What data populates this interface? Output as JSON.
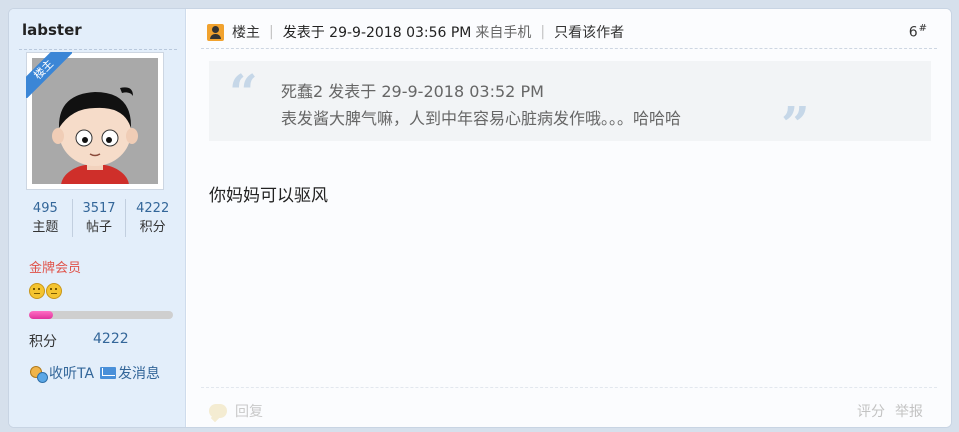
{
  "profile": {
    "username": "labster",
    "ribbon": "楼主",
    "stats": [
      {
        "value": "495",
        "label": "主题"
      },
      {
        "value": "3517",
        "label": "帖子"
      },
      {
        "value": "4222",
        "label": "积分"
      }
    ],
    "rank": "金牌会员",
    "stars": 2,
    "progress_fraction": 0.17,
    "points_label": "积分",
    "points_value": "4222",
    "follow_label": "收听TA",
    "message_label": "发消息"
  },
  "post": {
    "louzhu": "楼主",
    "posted_at": "发表于 29-9-2018 03:56 PM",
    "source": "来自手机",
    "only_author": "只看该作者",
    "floor": "6",
    "floor_sup": "#",
    "quote": {
      "open_mark": "“",
      "close_mark": "”",
      "author_line": "死蠢2 发表于 29-9-2018 03:52 PM",
      "text": "表发酱大脾气嘛，人到中年容易心脏病发作哦。。。哈哈哈"
    },
    "body": "你妈妈可以驱风"
  },
  "footer": {
    "reply": "回复",
    "rate": "评分",
    "report": "举报"
  },
  "colors": {
    "page_bg": "#d6e0ec",
    "sidebar_bg": "#e3eefa",
    "link": "#336699",
    "rank": "#e0534a",
    "progress": "#e0339d"
  }
}
